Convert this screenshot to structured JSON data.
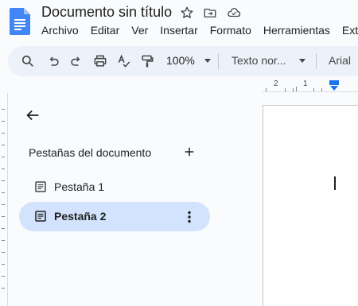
{
  "app": {
    "title": "Documento sin título",
    "menu": [
      "Archivo",
      "Editar",
      "Ver",
      "Insertar",
      "Formato",
      "Herramientas",
      "Exte"
    ]
  },
  "toolbar": {
    "zoom": "100%",
    "style": "Texto nor...",
    "font": "Arial"
  },
  "ruler": {
    "labels": [
      "2",
      "1"
    ]
  },
  "tabs_panel": {
    "heading": "Pestañas del documento",
    "tabs": [
      {
        "label": "Pestaña 1",
        "selected": false
      },
      {
        "label": "Pestaña 2",
        "selected": true
      }
    ]
  },
  "colors": {
    "accent": "#1a73e8",
    "selected_tab": "#d3e3fd",
    "toolbar_bg": "#edf2fa"
  }
}
